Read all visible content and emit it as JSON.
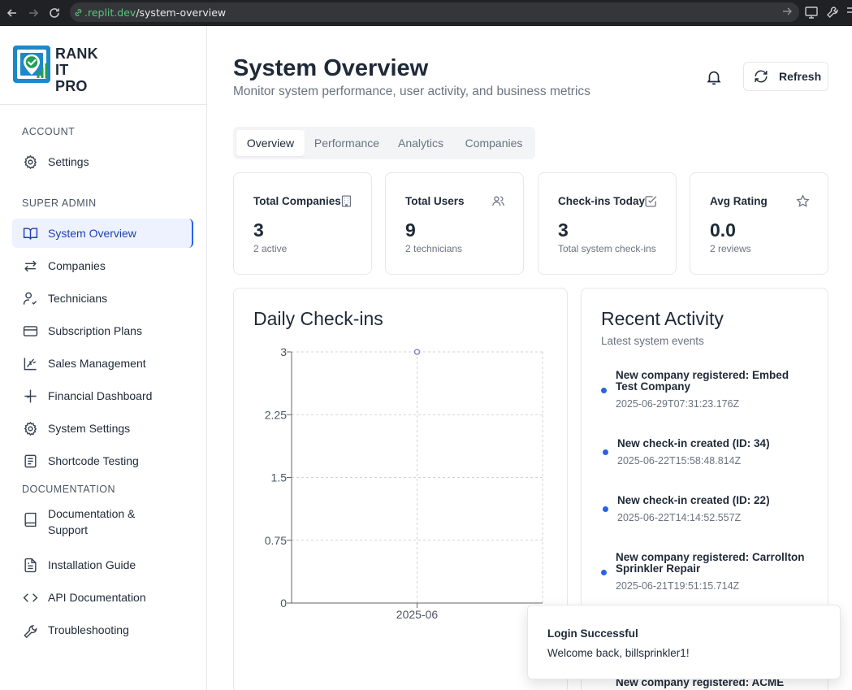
{
  "browser": {
    "url_host": ".replit.dev",
    "url_path": "/system-overview"
  },
  "brand": {
    "line1": "RANK",
    "line2": "IT",
    "line3": "PRO"
  },
  "sidebar": {
    "sections": [
      {
        "title": "ACCOUNT",
        "items": [
          {
            "label": "Settings",
            "icon": "gear-icon"
          }
        ]
      },
      {
        "title": "SUPER ADMIN",
        "items": [
          {
            "label": "System Overview",
            "icon": "book-open-icon",
            "active": true
          },
          {
            "label": "Companies",
            "icon": "arrows-exchange-icon"
          },
          {
            "label": "Technicians",
            "icon": "user-check-icon"
          },
          {
            "label": "Subscription Plans",
            "icon": "credit-card-icon"
          },
          {
            "label": "Sales Management",
            "icon": "chart-scatter-icon"
          },
          {
            "label": "Financial Dashboard",
            "icon": "sparkle-icon"
          },
          {
            "label": "System Settings",
            "icon": "gear-icon"
          },
          {
            "label": "Shortcode Testing",
            "icon": "document-lines-icon"
          }
        ]
      },
      {
        "title": "DOCUMENTATION",
        "items": [
          {
            "label": "Documentation & Support",
            "label_line1": "Documentation &",
            "label_line2": "Support",
            "icon": "book-icon"
          },
          {
            "label": "Installation Guide",
            "icon": "file-text-icon"
          },
          {
            "label": "API Documentation",
            "icon": "code-icon"
          },
          {
            "label": "Troubleshooting",
            "icon": "wrench-icon"
          }
        ]
      }
    ]
  },
  "header": {
    "title": "System Overview",
    "subtitle": "Monitor system performance, user activity, and business metrics",
    "refresh_label": "Refresh"
  },
  "tabs": [
    {
      "label": "Overview",
      "active": true
    },
    {
      "label": "Performance"
    },
    {
      "label": "Analytics"
    },
    {
      "label": "Companies"
    }
  ],
  "stats": [
    {
      "label": "Total Companies",
      "value": "3",
      "sub": "2 active",
      "icon": "building-icon"
    },
    {
      "label": "Total Users",
      "value": "9",
      "sub": "2 technicians",
      "icon": "users-icon"
    },
    {
      "label": "Check-ins Today",
      "value": "3",
      "sub": "Total system check-ins",
      "icon": "check-square-icon"
    },
    {
      "label": "Avg Rating",
      "value": "0.0",
      "sub": "2 reviews",
      "icon": "star-icon"
    }
  ],
  "chart_card": {
    "title": "Daily Check-ins"
  },
  "chart_data": {
    "type": "line",
    "title": "Daily Check-ins",
    "xlabel": "",
    "ylabel": "",
    "categories": [
      "2025-06"
    ],
    "values": [
      3
    ],
    "ylim": [
      0,
      3
    ],
    "yticks": [
      "0",
      "0.75",
      "1.5",
      "2.25",
      "3"
    ],
    "grid": true,
    "color": "#8884d8"
  },
  "activity": {
    "title": "Recent Activity",
    "subtitle": "Latest system events",
    "items": [
      {
        "title_l1": "New company registered: Embed",
        "title_l2": "Test Company",
        "time": "2025-06-29T07:31:23.176Z"
      },
      {
        "title_l1": "New check-in created (ID: 34)",
        "title_l2": "",
        "time": "2025-06-22T15:58:48.814Z"
      },
      {
        "title_l1": "New check-in created (ID: 22)",
        "title_l2": "",
        "time": "2025-06-22T14:14:52.557Z"
      },
      {
        "title_l1": "New company registered: Carrollton",
        "title_l2": "Sprinkler Repair",
        "time": "2025-06-21T19:51:15.714Z"
      },
      {
        "title_l1": "New company registered: ACME",
        "title_l2": "",
        "time": ""
      }
    ]
  },
  "toast": {
    "title": "Login Successful",
    "description": "Welcome back, billsprinkler1!"
  },
  "colors": {
    "accent": "#2563eb",
    "active_bg": "#eef2ff",
    "chart_line": "#8884d8"
  }
}
